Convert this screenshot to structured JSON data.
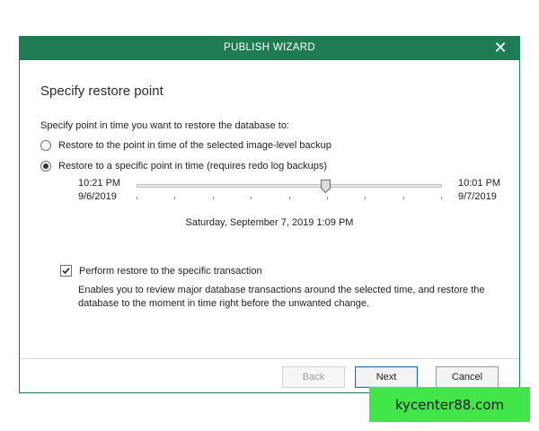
{
  "window": {
    "title": "PUBLISH WIZARD",
    "close_glyph": "✕"
  },
  "step": {
    "heading": "Specify restore point",
    "prompt": "Specify point in time you want to restore the database to:"
  },
  "options": {
    "latest_label": "Restore to the point in time of the selected image-level backup",
    "specific_label": "Restore to a specific point in time (requires redo log backups)",
    "selected": "specific"
  },
  "slider": {
    "start_time": "10:21 PM",
    "start_date": "9/6/2019",
    "end_time": "10:01 PM",
    "end_date": "9/7/2019",
    "position_fraction": 0.62,
    "tick_count": 9,
    "selected_label": "Saturday, September 7, 2019 1:09 PM"
  },
  "transaction": {
    "checked": true,
    "label": "Perform restore to the specific transaction",
    "description": "Enables you to review major database transactions around the selected time, and restore the database to the moment in time right before the unwanted change."
  },
  "buttons": {
    "back": "Back",
    "next": "Next",
    "cancel": "Cancel"
  },
  "watermark": {
    "text": "kycenter88.com"
  },
  "colors": {
    "titlebar": "#1e7b54",
    "watermark": "#42e64a",
    "primary_border": "#1f6fb5"
  }
}
